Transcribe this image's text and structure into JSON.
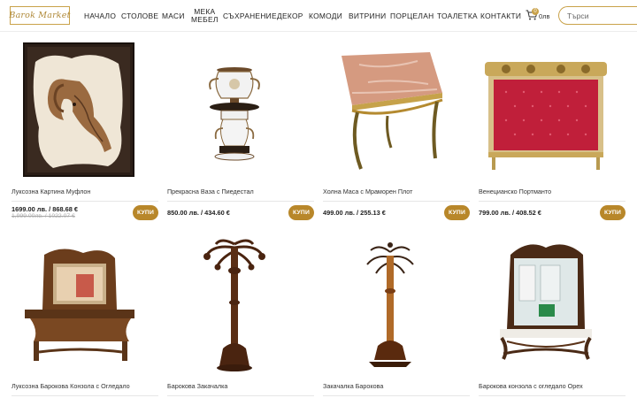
{
  "brand": {
    "logo_text": "Barok Market"
  },
  "nav": {
    "items": [
      {
        "label": "НАЧАЛО"
      },
      {
        "label": "СТОЛОВЕ"
      },
      {
        "label": "МАСИ"
      },
      {
        "label_line1": "МЕКА",
        "label_line2": "МЕБЕЛ"
      },
      {
        "label": "СЪХРАНЕНИЕ"
      },
      {
        "label": "ДЕКОР"
      },
      {
        "label": "КОМОДИ"
      },
      {
        "label": "ВИТРИНИ"
      },
      {
        "label": "ПОРЦЕЛАН"
      },
      {
        "label": "ТОАЛЕТКА"
      },
      {
        "label": "КОНТАКТИ"
      }
    ]
  },
  "cart": {
    "count": "0",
    "total": "0лв",
    "icon": "shopping-cart-icon"
  },
  "search": {
    "placeholder": "Търси"
  },
  "buy_label": "КУПИ",
  "accent_color": "#b8872a",
  "products": [
    {
      "name": "Луксозна Картина Муфлон",
      "price": "1699.00 лв. / 868.68 €",
      "old_price": "1,999.00лв. / 1022.07 €",
      "image": "ram-painting"
    },
    {
      "name": "Прекрасна Ваза с Пиедестал",
      "price": "850.00 лв. / 434.60 €",
      "image": "vase-pedestal"
    },
    {
      "name": "Холна Маса с Мраморен Плот",
      "price": "499.00 лв. / 255.13 €",
      "image": "marble-table"
    },
    {
      "name": "Венецианско Портманто",
      "price": "799.00 лв. / 408.52 €",
      "image": "venetian-coat-rack"
    },
    {
      "name": "Луксозна Барокова Конзола с Огледало",
      "image": "baroque-console-mirror"
    },
    {
      "name": "Барокова Закачалка",
      "image": "baroque-coat-stand"
    },
    {
      "name": "Закачалка Барокова",
      "image": "coat-stand-baroque"
    },
    {
      "name": "Барокова конзола с огледало Орех",
      "image": "walnut-console-mirror"
    }
  ]
}
